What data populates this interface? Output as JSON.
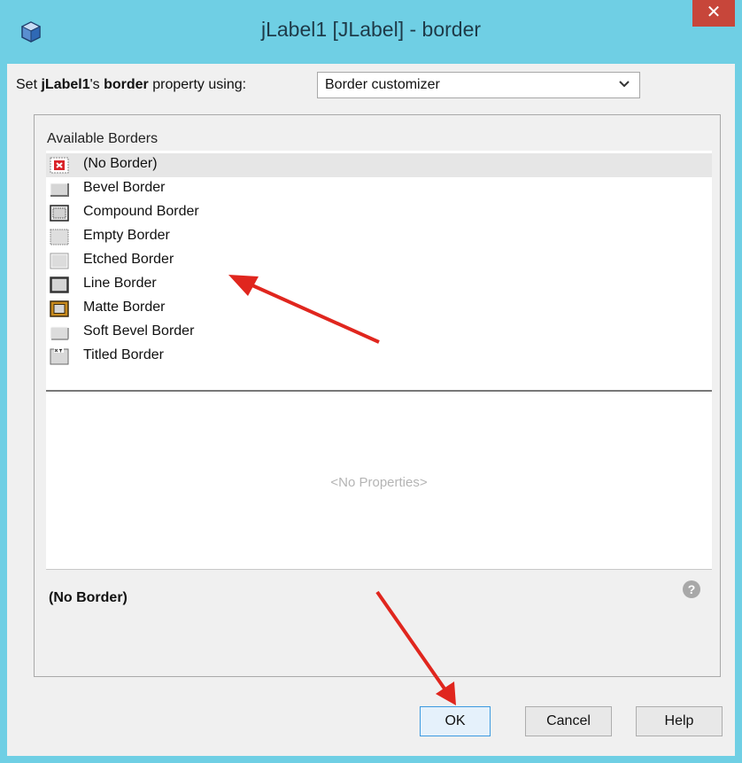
{
  "window": {
    "title": "jLabel1 [JLabel] - border",
    "close_label": "✕"
  },
  "property_row": {
    "prefix": "Set ",
    "component": "jLabel1",
    "possessive": "'s ",
    "property": "border",
    "suffix": " property using:",
    "selected_option": "Border customizer"
  },
  "available_borders": {
    "label": "Available Borders",
    "items": [
      {
        "label": "(No Border)",
        "icon": "no-border-icon",
        "selected": true
      },
      {
        "label": "Bevel Border",
        "icon": "bevel-border-icon"
      },
      {
        "label": "Compound Border",
        "icon": "compound-border-icon"
      },
      {
        "label": "Empty Border",
        "icon": "empty-border-icon"
      },
      {
        "label": "Etched Border",
        "icon": "etched-border-icon"
      },
      {
        "label": "Line Border",
        "icon": "line-border-icon"
      },
      {
        "label": "Matte Border",
        "icon": "matte-border-icon"
      },
      {
        "label": "Soft Bevel Border",
        "icon": "soft-bevel-border-icon"
      },
      {
        "label": "Titled Border",
        "icon": "titled-border-icon"
      }
    ]
  },
  "properties_panel": {
    "empty_text": "<No Properties>"
  },
  "status": {
    "selected_name": "(No Border)"
  },
  "buttons": {
    "ok": "OK",
    "cancel": "Cancel",
    "help": "Help"
  },
  "colors": {
    "title_bar": "#6fcfe4",
    "close_button": "#c7463a",
    "annotation_arrow": "#e0261e"
  }
}
